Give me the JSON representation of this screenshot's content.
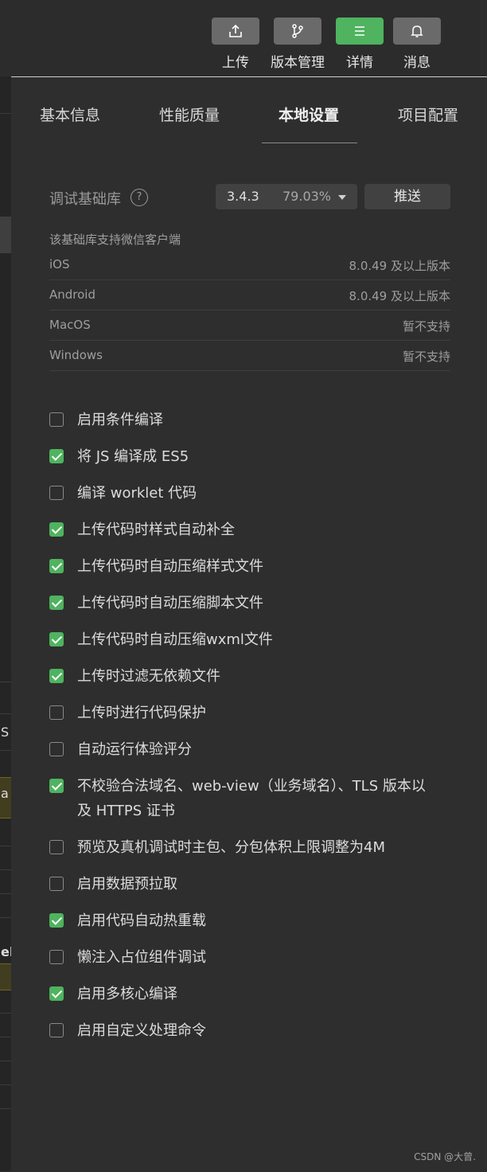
{
  "toolbar": {
    "buttons": [
      {
        "label": "上传",
        "icon": "upload-icon",
        "active": false
      },
      {
        "label": "版本管理",
        "icon": "branch-icon",
        "active": false
      },
      {
        "label": "详情",
        "icon": "menu-icon",
        "active": true
      },
      {
        "label": "消息",
        "icon": "bell-icon",
        "active": false
      }
    ]
  },
  "tabs": [
    {
      "label": "基本信息",
      "active": false
    },
    {
      "label": "性能质量",
      "active": false
    },
    {
      "label": "本地设置",
      "active": true
    },
    {
      "label": "项目配置",
      "active": false
    }
  ],
  "debug_lib": {
    "label": "调试基础库",
    "help": "?",
    "version": "3.4.3",
    "percent": "79.03%",
    "push_label": "推送"
  },
  "support": {
    "title": "该基础库支持微信客户端",
    "rows": [
      {
        "os": "iOS",
        "version": "8.0.49 及以上版本"
      },
      {
        "os": "Android",
        "version": "8.0.49 及以上版本"
      },
      {
        "os": "MacOS",
        "version": "暂不支持"
      },
      {
        "os": "Windows",
        "version": "暂不支持"
      }
    ]
  },
  "options": [
    {
      "label": "启用条件编译",
      "checked": false
    },
    {
      "label": "将 JS 编译成 ES5",
      "checked": true
    },
    {
      "label": "编译 worklet 代码",
      "checked": false
    },
    {
      "label": "上传代码时样式自动补全",
      "checked": true
    },
    {
      "label": "上传代码时自动压缩样式文件",
      "checked": true
    },
    {
      "label": "上传代码时自动压缩脚本文件",
      "checked": true
    },
    {
      "label": "上传代码时自动压缩wxml文件",
      "checked": true
    },
    {
      "label": "上传时过滤无依赖文件",
      "checked": true
    },
    {
      "label": "上传时进行代码保护",
      "checked": false
    },
    {
      "label": "自动运行体验评分",
      "checked": false
    },
    {
      "label": "不校验合法域名、web-view（业务域名）、TLS 版本以及 HTTPS 证书",
      "checked": true
    },
    {
      "label": "预览及真机调试时主包、分包体积上限调整为4M",
      "checked": false
    },
    {
      "label": "启用数据预拉取",
      "checked": false
    },
    {
      "label": "启用代码自动热重载",
      "checked": true
    },
    {
      "label": "懒注入占位组件调试",
      "checked": false
    },
    {
      "label": "启用多核心编译",
      "checked": true
    },
    {
      "label": "启用自定义处理命令",
      "checked": false
    }
  ],
  "background": {
    "chars": [
      "S",
      "a",
      "el"
    ]
  },
  "watermark": "CSDN @大曾."
}
